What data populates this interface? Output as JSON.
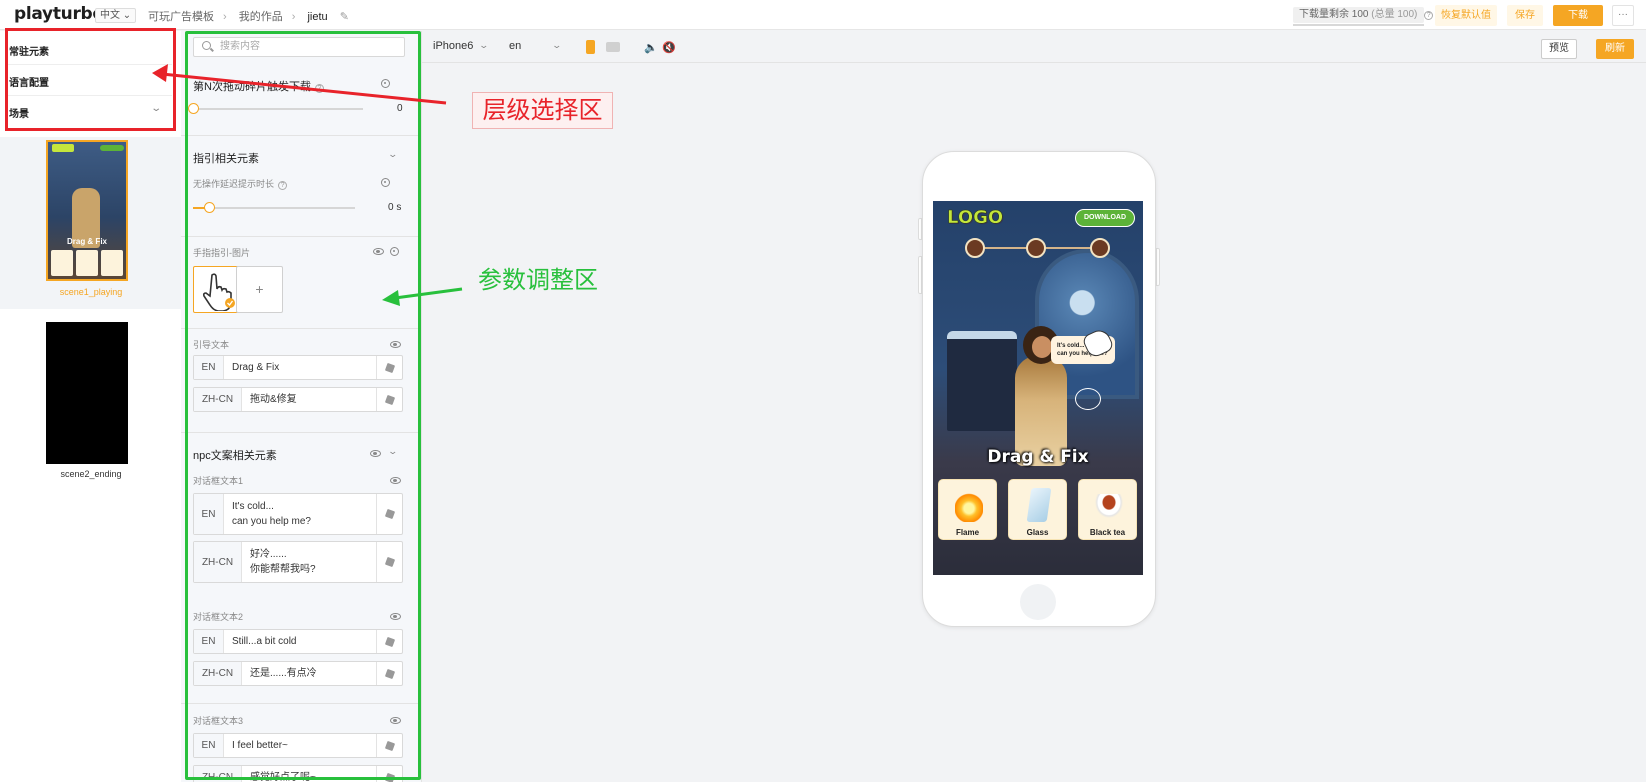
{
  "topbar": {
    "logo_main": "playturbo",
    "lang_select": "中文",
    "breadcrumbs": [
      "可玩广告模板",
      "我的作品",
      "jietu"
    ],
    "quota_text": "下载量剩余 100",
    "quota_total": "(总量 100)",
    "restore_label": "恢复默认值",
    "save_label": "保存",
    "download_label": "下载",
    "more_label": "···"
  },
  "left_panel": {
    "items": [
      {
        "label": "常驻元素"
      },
      {
        "label": "语言配置"
      },
      {
        "label": "场景"
      }
    ],
    "scenes": [
      {
        "name": "scene1_playing",
        "selected": true
      },
      {
        "name": "scene2_ending",
        "selected": false
      }
    ]
  },
  "params": {
    "search_placeholder": "搜索内容",
    "download_trigger": {
      "label": "第N次拖动碎片触发下载",
      "value": "0"
    },
    "guide_section": {
      "title": "指引相关元素"
    },
    "idle_delay": {
      "label": "无操作延迟提示时长",
      "value": "0",
      "unit": "s"
    },
    "hand_image": {
      "label": "手指指引-图片",
      "add": "+"
    },
    "guide_text": {
      "label": "引导文本",
      "rows": [
        {
          "lang": "EN",
          "text": "Drag & Fix"
        },
        {
          "lang": "ZH-CN",
          "text": "拖动&修复"
        }
      ]
    },
    "npc_section": {
      "title": "npc文案相关元素"
    },
    "dialogs": [
      {
        "label": "对话框文本1",
        "rows": [
          {
            "lang": "EN",
            "text": "It's cold...\ncan you help me?"
          },
          {
            "lang": "ZH-CN",
            "text": "好冷......\n你能帮帮我吗?"
          }
        ]
      },
      {
        "label": "对话框文本2",
        "rows": [
          {
            "lang": "EN",
            "text": "Still...a bit cold"
          },
          {
            "lang": "ZH-CN",
            "text": "还是......有点冷"
          }
        ]
      },
      {
        "label": "对话框文本3",
        "rows": [
          {
            "lang": "EN",
            "text": "I feel better~"
          },
          {
            "lang": "ZH-CN",
            "text": "感觉好点了呢~"
          }
        ]
      }
    ]
  },
  "preview_toolbar": {
    "device": "iPhone6",
    "language": "en",
    "preview_label": "预览",
    "refresh_label": "刷新"
  },
  "game": {
    "logo": "LOGO",
    "download_btn": "DOWNLOAD",
    "bubble_line1": "It's cold...",
    "bubble_line2": "can you help me?",
    "title": "Drag & Fix",
    "cards": [
      {
        "label": "Flame"
      },
      {
        "label": "Glass"
      },
      {
        "label": "Black tea"
      }
    ]
  },
  "annotations": {
    "layer_label": "层级选择区",
    "param_label": "参数调整区"
  },
  "colors": {
    "accent": "#f5a623",
    "annotation_red": "#e8232a",
    "annotation_green": "#28c03c"
  }
}
